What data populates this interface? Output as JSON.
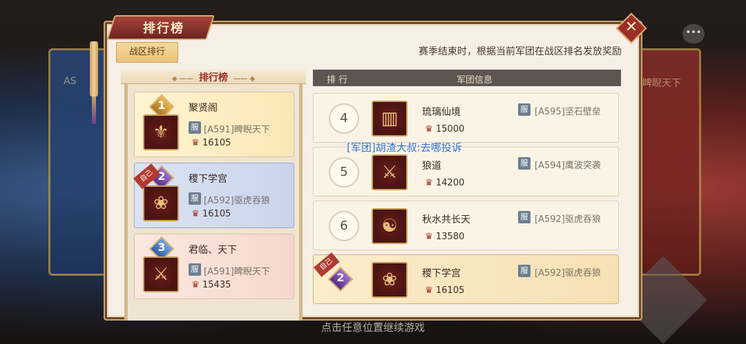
{
  "window": {
    "title": "排行榜",
    "close_symbol": "✕",
    "chat_icon_symbol": "•••"
  },
  "background": {
    "left_label": "AS",
    "right_label": "睥睨天下"
  },
  "tab": {
    "label": "战区排行"
  },
  "notice": "赛季结束时，根据当前军团在战区排名发放奖励",
  "podium": {
    "title": "排行榜",
    "self_tag": "自己",
    "entries": [
      {
        "rank": "1",
        "name": "聚贤阁",
        "server_tag": "服",
        "server": "[A591]睥睨天下",
        "score": "16105",
        "icon": "helmet-emblem-icon"
      },
      {
        "rank": "2",
        "name": "稷下学宫",
        "server_tag": "服",
        "server": "[A592]驱虎吞狼",
        "score": "16105",
        "icon": "lotus-emblem-icon"
      },
      {
        "rank": "3",
        "name": "君临、天下",
        "server_tag": "服",
        "server": "[A591]睥睨天下",
        "score": "15435",
        "icon": "sword-emblem-icon"
      }
    ]
  },
  "list": {
    "col_rank": "排 行",
    "col_info": "军团信息",
    "rows": [
      {
        "rank": "4",
        "name": "琉璃仙境",
        "server_tag": "服",
        "server": "[A595]坚石壁垒",
        "score": "15000",
        "icon": "pillar-emblem-icon"
      },
      {
        "rank": "5",
        "name": "狼道",
        "server_tag": "服",
        "server": "[A594]鹰波突袭",
        "score": "14200",
        "icon": "sword-emblem-icon"
      },
      {
        "rank": "6",
        "name": "秋水共长天",
        "server_tag": "服",
        "server": "[A592]驱虎吞狼",
        "score": "13580",
        "icon": "yinyang-emblem-icon"
      }
    ],
    "self_row": {
      "rank": "2",
      "name": "稷下学宫",
      "server_tag": "服",
      "server": "[A592]驱虎吞狼",
      "score": "16105",
      "self_tag": "自己",
      "icon": "lotus-emblem-icon"
    }
  },
  "chat_overlay": "[军团]胡渣大叔:去哪投诉",
  "continue_hint": "点击任意位置继续游戏",
  "icons": {
    "score": "♛",
    "helmet": "⚜",
    "lotus": "❀",
    "sword": "⚔",
    "pillar": "▥",
    "yinyang": "☯"
  }
}
